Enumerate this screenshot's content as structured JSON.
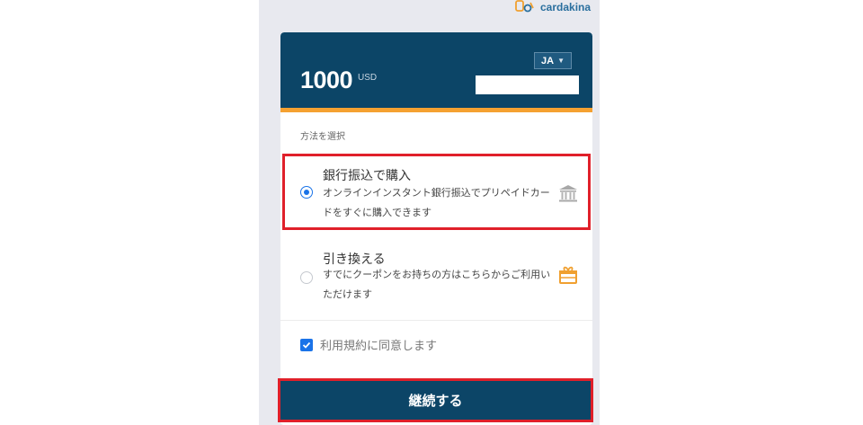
{
  "brand": {
    "name": "cardakina",
    "icon": "cardakina-logo-icon"
  },
  "header": {
    "amount": "1000",
    "currency": "USD",
    "language": "JA"
  },
  "method": {
    "label": "方法を選択",
    "options": [
      {
        "title": "銀行振込で購入",
        "description": "オンラインインスタント銀行振込でプリペイドカードをすぐに購入できます",
        "icon": "bank-icon",
        "selected": true
      },
      {
        "title": "引き換える",
        "description": "すでにクーポンをお持ちの方はこちらからご利用いただけます",
        "icon": "gift-icon",
        "selected": false
      }
    ]
  },
  "agreement": {
    "label": "利用規約に同意します",
    "checked": true
  },
  "continue_button": {
    "label": "継続する"
  },
  "colors": {
    "header_bg": "#0c4567",
    "accent_bar": "#f5a131",
    "highlight": "#e0202a",
    "radio_selected": "#1a73e8",
    "icon_gift": "#f0a030"
  }
}
